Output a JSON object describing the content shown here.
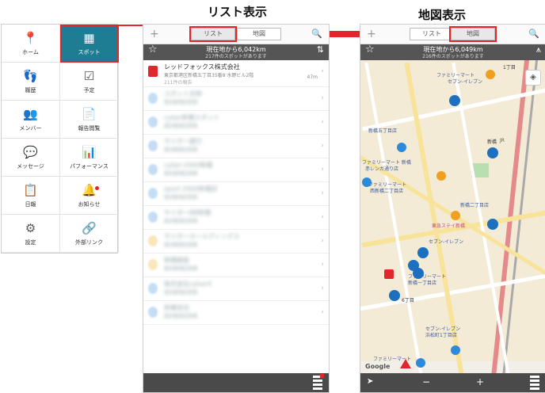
{
  "headings": {
    "list": "リスト表示",
    "map": "地図表示"
  },
  "menu": [
    {
      "label": "ホーム",
      "icon": "map-pin-icon",
      "glyph": "📍"
    },
    {
      "label": "スポット",
      "icon": "building-icon",
      "glyph": "▦",
      "active": true
    },
    {
      "label": "履歴",
      "icon": "footprints-icon",
      "glyph": "👣"
    },
    {
      "label": "予定",
      "icon": "calendar-check-icon",
      "glyph": "☑"
    },
    {
      "label": "メンバー",
      "icon": "members-icon",
      "glyph": "👥"
    },
    {
      "label": "報告閲覧",
      "icon": "document-icon",
      "glyph": "📄"
    },
    {
      "label": "メッセージ",
      "icon": "message-icon",
      "glyph": "💬"
    },
    {
      "label": "パフォーマンス",
      "icon": "bar-chart-icon",
      "glyph": "📊"
    },
    {
      "label": "日報",
      "icon": "report-icon",
      "glyph": "📋"
    },
    {
      "label": "お知らせ",
      "icon": "bell-icon",
      "glyph": "🔔"
    },
    {
      "label": "設定",
      "icon": "settings-icon",
      "glyph": "⚙"
    },
    {
      "label": "外部リンク",
      "icon": "link-icon",
      "glyph": "🔗"
    }
  ],
  "list_screen": {
    "add": "+",
    "tab_list": "リスト",
    "tab_map": "地図",
    "status_title": "現在地から6,042km",
    "status_sub": "217件のスポットがあります",
    "first_row": {
      "name": "レッドフォックス株式会社",
      "address": "東京都港区新橋五丁目35番8 水野ビル2階",
      "reports": "211件の報告",
      "distance": "47m"
    },
    "blurred_rows": [
      {
        "name": "スポット名称",
        "sub": "東京都港区新橋"
      },
      {
        "name": "cyber新橋スポット",
        "sub": "東京都港区新橋"
      },
      {
        "name": "サイボー銀行",
        "sub": "東京都港区新橋"
      },
      {
        "name": "cyber-2000新橋",
        "sub": "東京都港区新橋"
      },
      {
        "name": "sport 2000新橋店",
        "sub": "東京都港区新橋"
      },
      {
        "name": "サイボーBB新橋",
        "sub": "東京都港区新橋"
      },
      {
        "name": "サイボーホールディングス",
        "sub": "東京都港区新橋"
      },
      {
        "name": "新橋銀座",
        "sub": "東京都港区新橋"
      },
      {
        "name": "株式会社cyberX",
        "sub": "東京都港区新橋"
      },
      {
        "name": "新橋支店",
        "sub": "東京都港区新橋"
      }
    ]
  },
  "map_screen": {
    "add": "+",
    "tab_list": "リスト",
    "tab_map": "地図",
    "status_title": "現在地から6,049km",
    "status_sub": "216件のスポットがあります",
    "labels": {
      "family_a": "ファミリーマート",
      "seven_a": "セブン-イレブン",
      "shinbashi_5": "新橋五丁目店",
      "shinbashi": "新橋",
      "jr": "JR",
      "eki": "新橋駅",
      "family_b": "ファミリーマート 新橋",
      "akarenga": "赤レンガ通り店",
      "family_c": "ファミリーマート",
      "nishi_2": "西新橋二丁目店",
      "tokyu": "東急ステイ新橋",
      "seven_b": "セブン-イレブン",
      "family_d": "ファミリーマート",
      "shinbashi_1": "新橋一丁目店",
      "chome6": "6丁目",
      "seven_c": "セブン-イレブン",
      "hamamatsu": "浜松町1丁目店",
      "family_e": "ファミリーマート",
      "chome1": "1丁目",
      "shinbashi_2": "新橋二丁目店"
    },
    "google": "Google",
    "zoom_out": "−",
    "zoom_in": "+"
  }
}
